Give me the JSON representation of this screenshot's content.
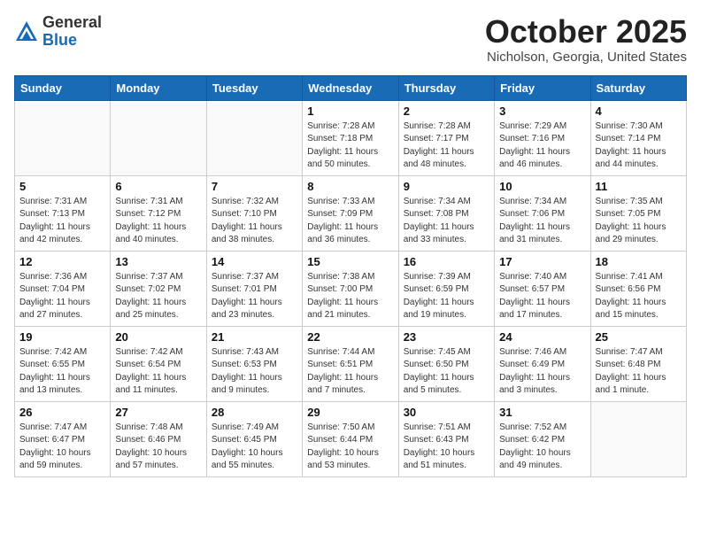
{
  "logo": {
    "general": "General",
    "blue": "Blue"
  },
  "header": {
    "month": "October 2025",
    "location": "Nicholson, Georgia, United States"
  },
  "weekdays": [
    "Sunday",
    "Monday",
    "Tuesday",
    "Wednesday",
    "Thursday",
    "Friday",
    "Saturday"
  ],
  "weeks": [
    [
      {
        "day": "",
        "info": ""
      },
      {
        "day": "",
        "info": ""
      },
      {
        "day": "",
        "info": ""
      },
      {
        "day": "1",
        "info": "Sunrise: 7:28 AM\nSunset: 7:18 PM\nDaylight: 11 hours\nand 50 minutes."
      },
      {
        "day": "2",
        "info": "Sunrise: 7:28 AM\nSunset: 7:17 PM\nDaylight: 11 hours\nand 48 minutes."
      },
      {
        "day": "3",
        "info": "Sunrise: 7:29 AM\nSunset: 7:16 PM\nDaylight: 11 hours\nand 46 minutes."
      },
      {
        "day": "4",
        "info": "Sunrise: 7:30 AM\nSunset: 7:14 PM\nDaylight: 11 hours\nand 44 minutes."
      }
    ],
    [
      {
        "day": "5",
        "info": "Sunrise: 7:31 AM\nSunset: 7:13 PM\nDaylight: 11 hours\nand 42 minutes."
      },
      {
        "day": "6",
        "info": "Sunrise: 7:31 AM\nSunset: 7:12 PM\nDaylight: 11 hours\nand 40 minutes."
      },
      {
        "day": "7",
        "info": "Sunrise: 7:32 AM\nSunset: 7:10 PM\nDaylight: 11 hours\nand 38 minutes."
      },
      {
        "day": "8",
        "info": "Sunrise: 7:33 AM\nSunset: 7:09 PM\nDaylight: 11 hours\nand 36 minutes."
      },
      {
        "day": "9",
        "info": "Sunrise: 7:34 AM\nSunset: 7:08 PM\nDaylight: 11 hours\nand 33 minutes."
      },
      {
        "day": "10",
        "info": "Sunrise: 7:34 AM\nSunset: 7:06 PM\nDaylight: 11 hours\nand 31 minutes."
      },
      {
        "day": "11",
        "info": "Sunrise: 7:35 AM\nSunset: 7:05 PM\nDaylight: 11 hours\nand 29 minutes."
      }
    ],
    [
      {
        "day": "12",
        "info": "Sunrise: 7:36 AM\nSunset: 7:04 PM\nDaylight: 11 hours\nand 27 minutes."
      },
      {
        "day": "13",
        "info": "Sunrise: 7:37 AM\nSunset: 7:02 PM\nDaylight: 11 hours\nand 25 minutes."
      },
      {
        "day": "14",
        "info": "Sunrise: 7:37 AM\nSunset: 7:01 PM\nDaylight: 11 hours\nand 23 minutes."
      },
      {
        "day": "15",
        "info": "Sunrise: 7:38 AM\nSunset: 7:00 PM\nDaylight: 11 hours\nand 21 minutes."
      },
      {
        "day": "16",
        "info": "Sunrise: 7:39 AM\nSunset: 6:59 PM\nDaylight: 11 hours\nand 19 minutes."
      },
      {
        "day": "17",
        "info": "Sunrise: 7:40 AM\nSunset: 6:57 PM\nDaylight: 11 hours\nand 17 minutes."
      },
      {
        "day": "18",
        "info": "Sunrise: 7:41 AM\nSunset: 6:56 PM\nDaylight: 11 hours\nand 15 minutes."
      }
    ],
    [
      {
        "day": "19",
        "info": "Sunrise: 7:42 AM\nSunset: 6:55 PM\nDaylight: 11 hours\nand 13 minutes."
      },
      {
        "day": "20",
        "info": "Sunrise: 7:42 AM\nSunset: 6:54 PM\nDaylight: 11 hours\nand 11 minutes."
      },
      {
        "day": "21",
        "info": "Sunrise: 7:43 AM\nSunset: 6:53 PM\nDaylight: 11 hours\nand 9 minutes."
      },
      {
        "day": "22",
        "info": "Sunrise: 7:44 AM\nSunset: 6:51 PM\nDaylight: 11 hours\nand 7 minutes."
      },
      {
        "day": "23",
        "info": "Sunrise: 7:45 AM\nSunset: 6:50 PM\nDaylight: 11 hours\nand 5 minutes."
      },
      {
        "day": "24",
        "info": "Sunrise: 7:46 AM\nSunset: 6:49 PM\nDaylight: 11 hours\nand 3 minutes."
      },
      {
        "day": "25",
        "info": "Sunrise: 7:47 AM\nSunset: 6:48 PM\nDaylight: 11 hours\nand 1 minute."
      }
    ],
    [
      {
        "day": "26",
        "info": "Sunrise: 7:47 AM\nSunset: 6:47 PM\nDaylight: 10 hours\nand 59 minutes."
      },
      {
        "day": "27",
        "info": "Sunrise: 7:48 AM\nSunset: 6:46 PM\nDaylight: 10 hours\nand 57 minutes."
      },
      {
        "day": "28",
        "info": "Sunrise: 7:49 AM\nSunset: 6:45 PM\nDaylight: 10 hours\nand 55 minutes."
      },
      {
        "day": "29",
        "info": "Sunrise: 7:50 AM\nSunset: 6:44 PM\nDaylight: 10 hours\nand 53 minutes."
      },
      {
        "day": "30",
        "info": "Sunrise: 7:51 AM\nSunset: 6:43 PM\nDaylight: 10 hours\nand 51 minutes."
      },
      {
        "day": "31",
        "info": "Sunrise: 7:52 AM\nSunset: 6:42 PM\nDaylight: 10 hours\nand 49 minutes."
      },
      {
        "day": "",
        "info": ""
      }
    ]
  ]
}
